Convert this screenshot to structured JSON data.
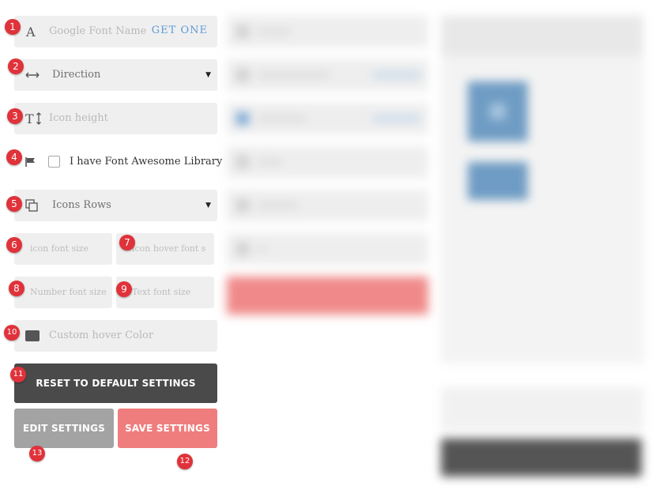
{
  "fields": {
    "google_font": {
      "placeholder": "Google Font Name",
      "link": "GET ONE"
    },
    "direction": {
      "value": "Direction"
    },
    "icon_height": {
      "placeholder": "Icon height"
    },
    "font_awesome": {
      "label": "I have Font Awesome Library",
      "checked": false
    },
    "icons_rows": {
      "value": "Icons Rows"
    },
    "icon_font_size": {
      "placeholder": "icon font size"
    },
    "icon_hover_font_size": {
      "placeholder": "icon hover font s"
    },
    "number_font_size": {
      "placeholder": "Number font size"
    },
    "text_font_size": {
      "placeholder": "Text font size"
    },
    "custom_hover_color": {
      "placeholder": "Custom hover Color",
      "swatch": "#555555"
    }
  },
  "buttons": {
    "reset": "RESET TO DEFAULT SETTINGS",
    "edit": "EDIT SETTINGS",
    "save": "SAVE SETTINGS"
  },
  "markers": [
    "1",
    "2",
    "3",
    "4",
    "5",
    "6",
    "7",
    "8",
    "9",
    "10",
    "11",
    "12",
    "13"
  ],
  "colors": {
    "marker": "#e0323a",
    "link": "#5b9bd5",
    "reset_button": "#4a4a4a",
    "edit_button": "#a3a3a3",
    "save_button": "#f07d7d"
  },
  "icons": {
    "google_font": "letter-a-icon",
    "direction": "horizontal-arrows-icon",
    "icon_height": "text-height-icon",
    "font_awesome": "flag-icon",
    "icons_rows": "copy-icon",
    "dropdown": "caret-down-icon"
  }
}
